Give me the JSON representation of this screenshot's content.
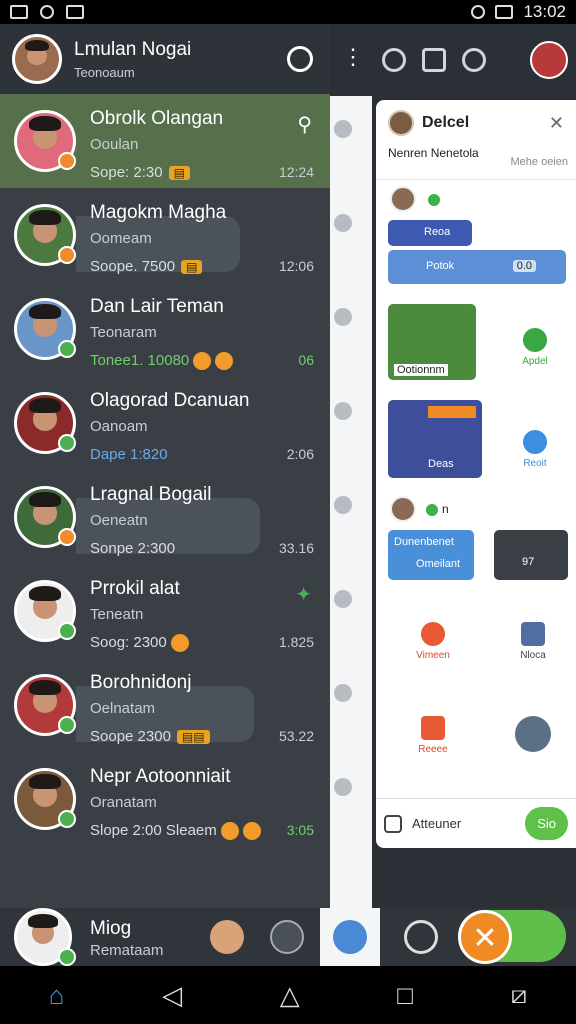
{
  "status_bar": {
    "time": "13:02"
  },
  "drawer": {
    "title": "Lmulan Nogai",
    "subtitle": "Teonoaum"
  },
  "chats": [
    {
      "name": "Obrolk Olangan",
      "sub": "Ooulan",
      "meta": "Sope: 2:30",
      "time": "12:24",
      "active": true
    },
    {
      "name": "Magokm Magha",
      "sub": "Oomeam",
      "meta": "Soope. 7500",
      "time": "12:06"
    },
    {
      "name": "Dan Lair Teman",
      "sub": "Teonaram",
      "meta": "Tonee1. 10080",
      "time": "06"
    },
    {
      "name": "Olagorad Dcanuan",
      "sub": "Oanoam",
      "meta": "Dape 1:820",
      "time": "2:06"
    },
    {
      "name": "Lragnal Bogail",
      "sub": "Oeneatn",
      "meta": "Sonpe 2:300",
      "time": "33.16"
    },
    {
      "name": "Prrokil alat",
      "sub": "Teneatn",
      "meta": "Soog: 2300",
      "time": "1.825"
    },
    {
      "name": "Borohnidonj",
      "sub": "Oelnatam",
      "meta": "Soope 2300",
      "time": "53.22"
    },
    {
      "name": "Nepr Aotoonniait",
      "sub": "Oranatam",
      "meta": "Slope 2:00 Sleaem",
      "time": "3:05"
    }
  ],
  "bottom_chat": {
    "name": "Miog",
    "sub": "Remataam"
  },
  "right_panel": {
    "title": "Delcel",
    "subtitle": "Nenren Nenetola",
    "subtitle2": "Mehe oeien",
    "card1_a": "Reoa",
    "card1_b": "Potok",
    "card1_c": "0.0",
    "card2_label": "Ootionnm",
    "card2_action": "Apdel",
    "card3_label": "Deas",
    "card3_action": "Reoit",
    "row_n": "n",
    "card4_a": "Dunenbenet",
    "card4_b": "Omeilant",
    "card5": "97",
    "action_left_1": "Vimeen",
    "action_right_1": "Nloca",
    "action_left_2": "Reeee",
    "footer_text": "Atteuner",
    "footer_button": "Sio"
  },
  "colors": {
    "active_chat": "#55704a",
    "accent_green": "#5fc04a",
    "accent_orange": "#f08a24"
  },
  "icons": [
    "home-icon",
    "back-icon",
    "home-outline-icon",
    "recents-icon",
    "screenshot-icon",
    "search-icon",
    "more-icon",
    "close-icon"
  ]
}
